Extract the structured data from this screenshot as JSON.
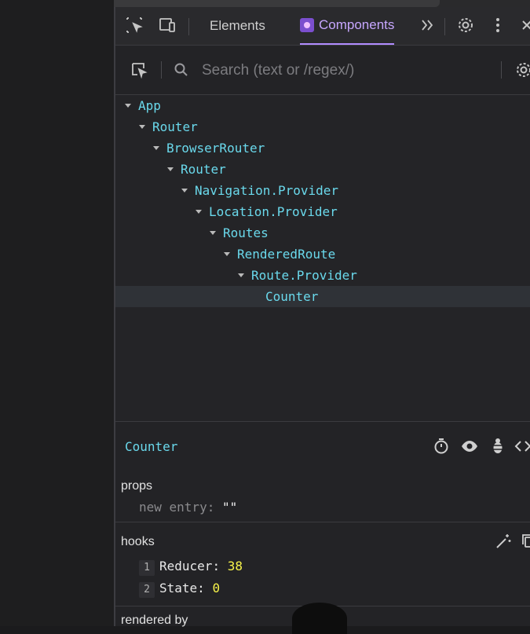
{
  "tabs": {
    "elements": "Elements",
    "components": "Components"
  },
  "search": {
    "placeholder": "Search (text or /regex/)"
  },
  "tree": [
    {
      "label": "App",
      "depth": 0,
      "expandable": true
    },
    {
      "label": "Router",
      "depth": 1,
      "expandable": true
    },
    {
      "label": "BrowserRouter",
      "depth": 2,
      "expandable": true
    },
    {
      "label": "Router",
      "depth": 3,
      "expandable": true
    },
    {
      "label": "Navigation.Provider",
      "depth": 4,
      "expandable": true
    },
    {
      "label": "Location.Provider",
      "depth": 5,
      "expandable": true
    },
    {
      "label": "Routes",
      "depth": 6,
      "expandable": true
    },
    {
      "label": "RenderedRoute",
      "depth": 7,
      "expandable": true
    },
    {
      "label": "Route.Provider",
      "depth": 8,
      "expandable": true
    },
    {
      "label": "Counter",
      "depth": 9,
      "expandable": false,
      "selected": true
    }
  ],
  "selected": {
    "name": "Counter",
    "props_title": "props",
    "props": [
      {
        "key": "new entry",
        "value": "\"\""
      }
    ],
    "hooks_title": "hooks",
    "hooks": [
      {
        "index": "1",
        "name": "Reducer",
        "value": "38"
      },
      {
        "index": "2",
        "name": "State",
        "value": "0"
      }
    ],
    "rendered_by_title": "rendered by"
  },
  "colors": {
    "accent": "#b18cff",
    "component": "#6ad9ec",
    "number": "#f7f34a"
  }
}
